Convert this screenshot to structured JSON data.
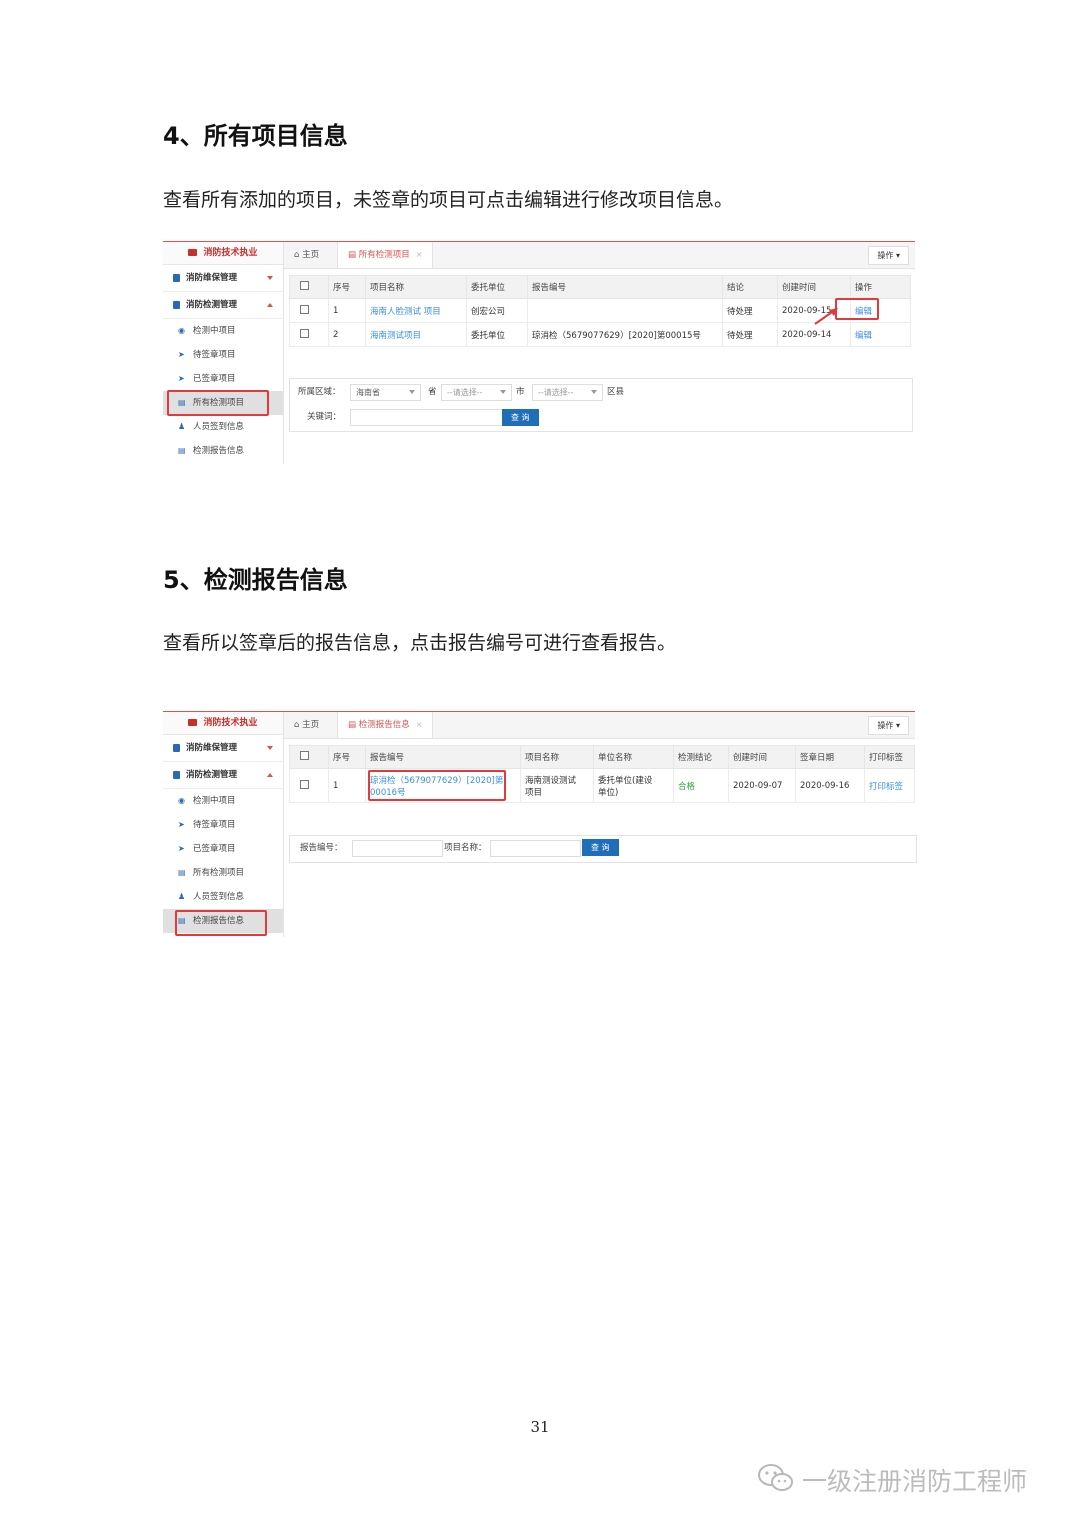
{
  "section4": {
    "heading": "4、所有项目信息",
    "desc": "查看所有添加的项目，未签章的项目可点击编辑进行修改项目信息。",
    "screenshot": {
      "brand": "消防技术执业",
      "menus": [
        {
          "label": "消防维保管理"
        },
        {
          "label": "消防检测管理"
        }
      ],
      "subs": [
        "检测中项目",
        "待签章项目",
        "已签章项目",
        "所有检测项目",
        "人员签到信息",
        "检测报告信息"
      ],
      "home_tab": "主页",
      "active_tab": "所有检测项目",
      "op_button": "操作 ▾",
      "columns": [
        "序号",
        "项目名称",
        "委托单位",
        "报告编号",
        "结论",
        "创建时间",
        "操作"
      ],
      "rows": [
        {
          "no": "1",
          "name": "海南人脸测试 项目",
          "client": "创宏公司",
          "report": "",
          "result": "待处理",
          "created": "2020-09-15",
          "action": "编辑"
        },
        {
          "no": "2",
          "name": "海南测试项目",
          "client": "委托单位",
          "report": "琼消检（5679077629）[2020]第00015号",
          "result": "待处理",
          "created": "2020-09-14",
          "action": "编辑"
        }
      ],
      "filter": {
        "region_label": "所属区域：",
        "province_value": "海南省",
        "province_unit": "省",
        "city_placeholder": "--请选择--",
        "city_unit": "市",
        "district_placeholder": "--请选择--",
        "district_unit": "区县",
        "keyword_label": "关键词：",
        "query_button": "查 询"
      }
    }
  },
  "section5": {
    "heading": "5、检测报告信息",
    "desc": "查看所以签章后的报告信息，点击报告编号可进行查看报告。",
    "screenshot": {
      "brand": "消防技术执业",
      "menus": [
        {
          "label": "消防维保管理"
        },
        {
          "label": "消防检测管理"
        }
      ],
      "subs": [
        "检测中项目",
        "待签章项目",
        "已签章项目",
        "所有检测项目",
        "人员签到信息",
        "检测报告信息"
      ],
      "home_tab": "主页",
      "active_tab": "检测报告信息",
      "op_button": "操作 ▾",
      "columns": [
        "序号",
        "报告编号",
        "项目名称",
        "单位名称",
        "检测结论",
        "创建时间",
        "签章日期",
        "打印标签"
      ],
      "rows": [
        {
          "no": "1",
          "report_l1": "琼消检（5679077629）[2020]第",
          "report_l2": "00016号",
          "name_l1": "海南测设测试",
          "name_l2": "项目",
          "unit_l1": "委托单位(建设",
          "unit_l2": "单位)",
          "result": "合格",
          "created": "2020-09-07",
          "signed": "2020-09-16",
          "print": "打印标签"
        }
      ],
      "filter": {
        "report_label": "报告编号：",
        "project_label": "项目名称：",
        "query_button": "查 询"
      }
    }
  },
  "page_number": "31",
  "watermark": "一级注册消防工程师"
}
